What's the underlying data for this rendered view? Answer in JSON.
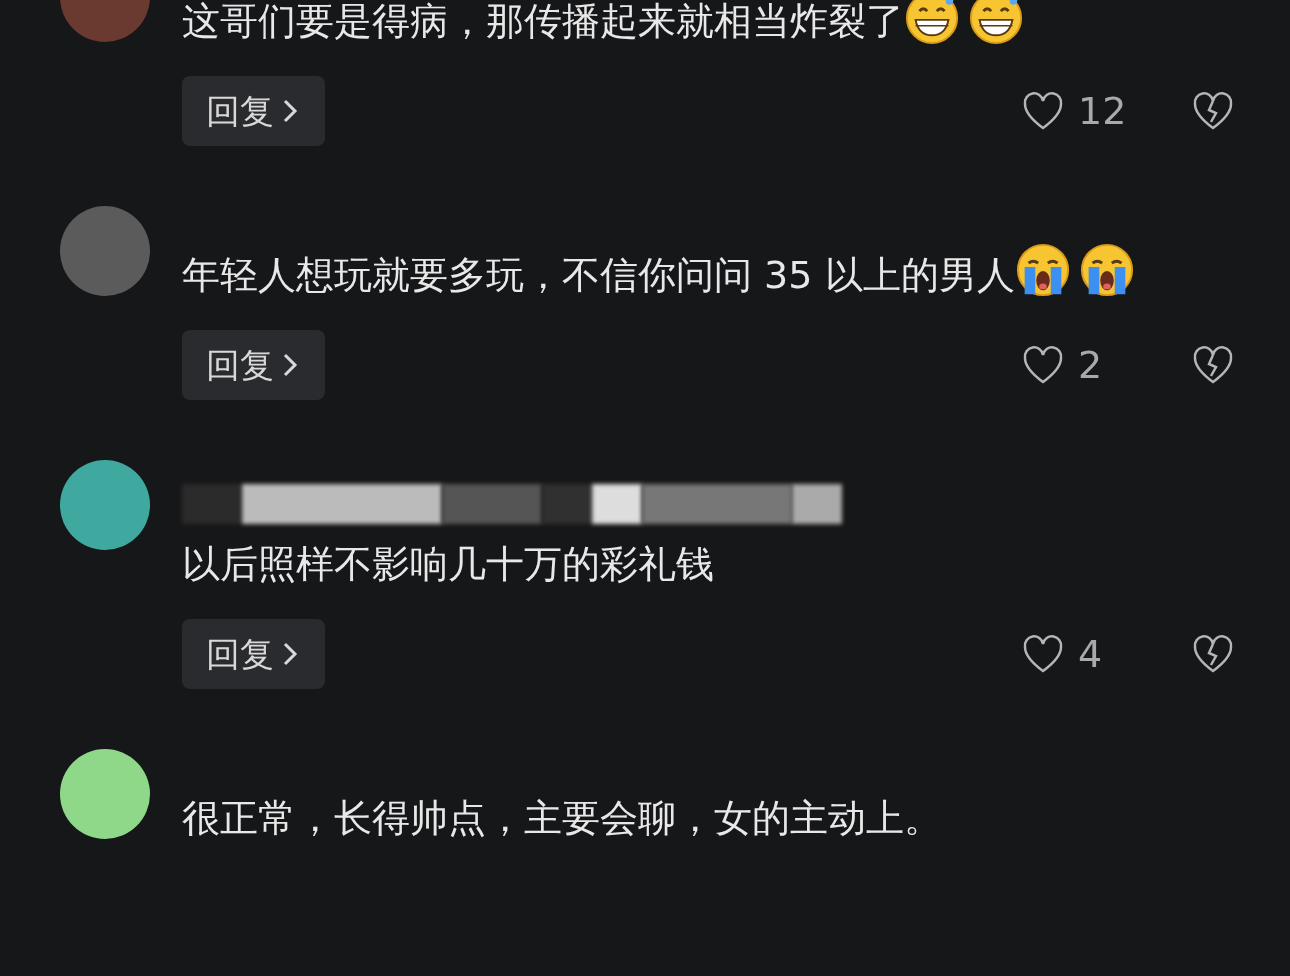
{
  "comments": [
    {
      "name_blurred": false,
      "text": "这哥们要是得病，那传播起来就相当炸裂了",
      "emojis": [
        {
          "kind": "grin_sweat"
        },
        {
          "kind": "grin_sweat"
        }
      ],
      "reply": "回复",
      "likes": "12"
    },
    {
      "name_blurred": false,
      "text": "年轻人想玩就要多玩，不信你问问 35 以上的男人",
      "emojis": [
        {
          "kind": "crying"
        },
        {
          "kind": "crying"
        }
      ],
      "reply": "回复",
      "likes": "2"
    },
    {
      "name_blurred": true,
      "text": "以后照样不影响几十万的彩礼钱",
      "reply": "回复",
      "likes": "4"
    },
    {
      "name_blurred": false,
      "text": "很正常，长得帅点，主要会聊，女的主动上。"
    }
  ]
}
